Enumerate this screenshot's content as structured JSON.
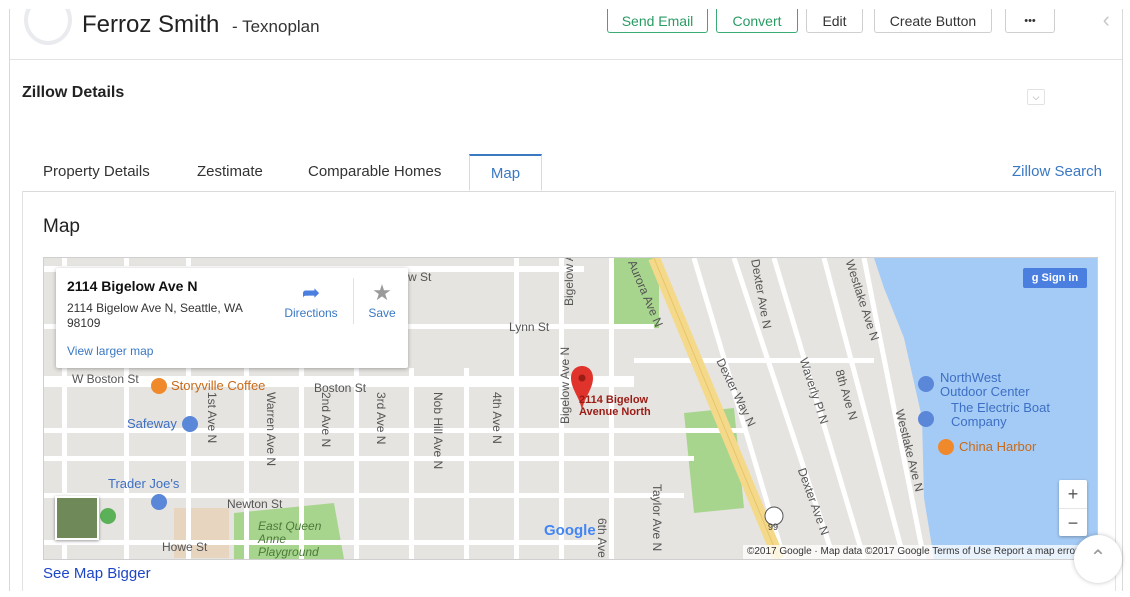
{
  "header": {
    "name": "Ferroz Smith",
    "company": "- Texnoplan",
    "buttons": {
      "send_email": "Send Email",
      "convert": "Convert",
      "edit": "Edit",
      "create_button": "Create Button",
      "more": "•••"
    },
    "collapse_icon": "chevron-left-icon"
  },
  "section": {
    "title": "Zillow Details",
    "toggle_icon": "chevron-down-icon"
  },
  "tabs": [
    {
      "label": "Property Details",
      "active": false
    },
    {
      "label": "Zestimate",
      "active": false
    },
    {
      "label": "Comparable Homes",
      "active": false
    },
    {
      "label": "Map",
      "active": true
    }
  ],
  "zillow_search": "Zillow Search",
  "map_panel": {
    "heading": "Map",
    "info_window": {
      "title": "2114 Bigelow Ave N",
      "address": "2114 Bigelow Ave N, Seattle, WA 98109",
      "view_larger": "View larger map",
      "directions": "Directions",
      "save": "Save"
    },
    "marker_label": "2114 Bigelow Avenue North",
    "sign_in": "Sign in",
    "zoom_in": "+",
    "zoom_out": "−",
    "google_logo": "Google",
    "footer": "©2017 Google · Map data ©2017 Google   Terms of Use   Report a map error",
    "streets": {
      "mcgraw": "McGraw St",
      "lynn": "Lynn St",
      "w_boston": "W Boston St",
      "boston": "Boston St",
      "newton": "Newton St",
      "howe": "Howe St",
      "aurora": "Aurora Ave N",
      "dexter_top": "Dexter Ave N",
      "dexter_way": "Dexter Way N",
      "dexter_low": "Dexter Ave N",
      "westlake_top": "Westlake Ave N",
      "westlake": "Westlake Ave N",
      "waverly": "Waverly Pl N",
      "eighth": "8th Ave N",
      "first": "1st Ave N",
      "warren": "Warren Ave N",
      "second": "2nd Ave N",
      "third": "3rd Ave N",
      "nob_hill": "Nob Hill Ave N",
      "fourth": "4th Ave N",
      "bigelow": "Bigelow Ave N",
      "bigelow_top": "Bigelow Ave N",
      "taylor": "Taylor Ave N",
      "sixth_n": "6th Ave N",
      "east_queen_anne": "East Queen Anne Playground",
      "highway": "99"
    },
    "places": {
      "storyville": "Storyville Coffee",
      "safeway": "Safeway",
      "trader_joes": "Trader Joe's",
      "northwest_outdoor": "NorthWest Outdoor Center",
      "boat_company": "The Electric Boat Company",
      "china_harbor": "China Harbor"
    }
  },
  "map_bigger": "See Map Bigger",
  "colors": {
    "accent_blue": "#3a78c2",
    "button_green": "#2a9b63",
    "water": "#a4cbf6",
    "park": "#a8d58e",
    "road": "#ffffff",
    "highway": "#f5d98b",
    "marker": "#e0332b"
  }
}
